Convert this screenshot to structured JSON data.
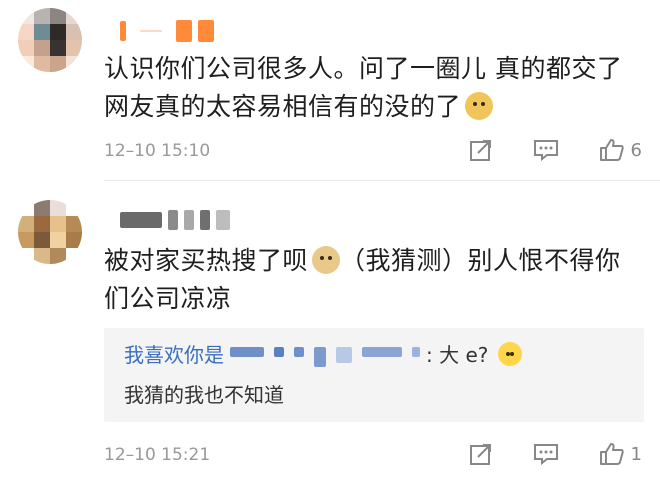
{
  "comments": [
    {
      "text": "认识你们公司很多人。问了一圈儿 真的都交了 网友真的太容易相信有的没的了",
      "emoji": "doge-emoji",
      "timestamp": "12–10 15:10",
      "like_count": "6"
    },
    {
      "text": "被对家买热搜了呗",
      "text_after_emoji": "（我猜测）别人恨不得你们公司凉凉",
      "emoji": "doge-emoji",
      "timestamp": "12–10 15:21",
      "like_count": "1",
      "reply": {
        "author_prefix": "我喜欢你是",
        "text_suffix": ": 大 e?",
        "emoji": "thinking-emoji",
        "body": "我猜的我也不知道"
      }
    }
  ],
  "colors": {
    "link": "#3a6fbf",
    "meta": "#999999",
    "reply_bg": "#f4f4f4"
  }
}
